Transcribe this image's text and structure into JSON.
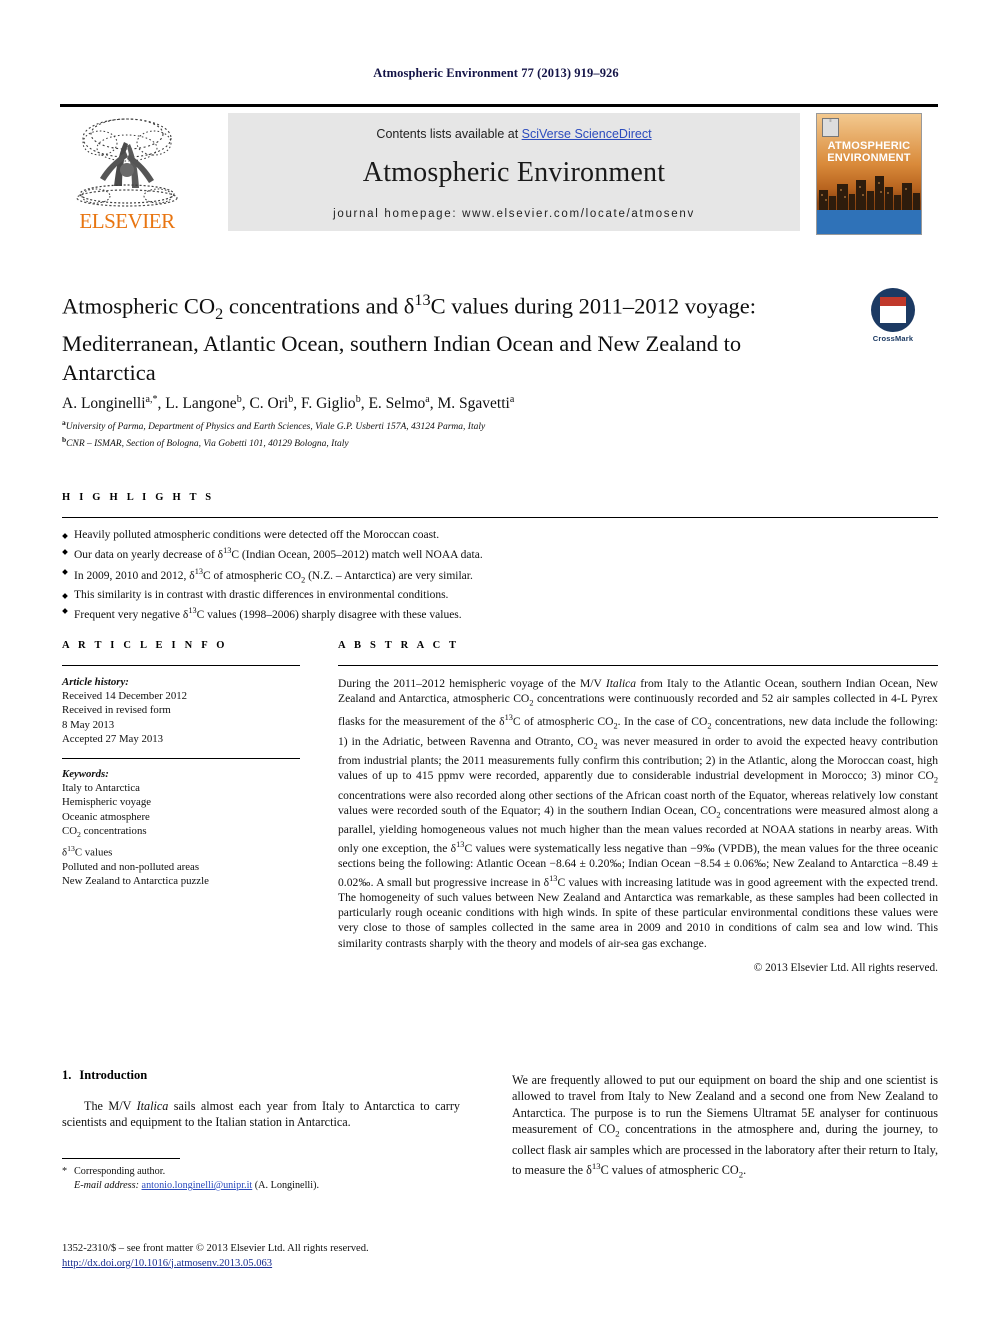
{
  "running_head": "Atmospheric Environment 77 (2013) 919–926",
  "masthead": {
    "publisher_name": "ELSEVIER",
    "contents_prefix": "Contents lists available at ",
    "contents_link": "SciVerse ScienceDirect",
    "journal_name": "Atmospheric Environment",
    "homepage": "journal homepage: www.elsevier.com/locate/atmosenv",
    "cover": {
      "line1": "ATMOSPHERIC",
      "line2": "ENVIRONMENT"
    }
  },
  "article": {
    "title_line1_a": "Atmospheric CO",
    "title_line1_b": " concentrations and δ",
    "title_line1_c": "C values during 2011–2012",
    "title_sub": "2",
    "title_sup": "13",
    "title_line2": "voyage: Mediterranean, Atlantic Ocean, southern Indian Ocean and",
    "title_line3": "New Zealand to Antarctica",
    "crossmark_label": "CrossMark",
    "authors": "A. Longinelli, L. Langone, C. Ori, F. Giglio, E. Selmo, M. Sgavetti",
    "author_list": [
      {
        "name": "A. Longinelli",
        "marks": "a,*"
      },
      {
        "name": "L. Langone",
        "marks": "b"
      },
      {
        "name": "C. Ori",
        "marks": "b"
      },
      {
        "name": "F. Giglio",
        "marks": "b"
      },
      {
        "name": "E. Selmo",
        "marks": "a"
      },
      {
        "name": "M. Sgavetti",
        "marks": "a"
      }
    ],
    "affiliations": [
      {
        "mark": "a",
        "text": "University of Parma, Department of Physics and Earth Sciences, Viale G.P. Usberti 157A, 43124 Parma, Italy"
      },
      {
        "mark": "b",
        "text": "CNR – ISMAR, Section of Bologna, Via Gobetti 101, 40129 Bologna, Italy"
      }
    ]
  },
  "highlights": {
    "heading": "H I G H L I G H T S",
    "items": [
      "Heavily polluted atmospheric conditions were detected off the Moroccan coast.",
      "Our data on yearly decrease of δ13C (Indian Ocean, 2005–2012) match well NOAA data.",
      "In 2009, 2010 and 2012, δ13C of atmospheric CO2 (N.Z. – Antarctica) are very similar.",
      "This similarity is in contrast with drastic differences in environmental conditions.",
      "Frequent very negative δ13C values (1998–2006) sharply disagree with these values."
    ]
  },
  "article_info": {
    "heading": "A R T I C L E  I N F O",
    "history_label": "Article history:",
    "history": [
      "Received 14 December 2012",
      "Received in revised form",
      "8 May 2013",
      "Accepted 27 May 2013"
    ],
    "keywords_label": "Keywords:",
    "keywords": [
      "Italy to Antarctica",
      "Hemispheric voyage",
      "Oceanic atmosphere",
      "CO2 concentrations",
      "δ13C values",
      "Polluted and non-polluted areas",
      "New Zealand to Antarctica puzzle"
    ]
  },
  "abstract": {
    "heading": "A B S T R A C T",
    "text_pre_italic": "During the 2011–2012 hemispheric voyage of the M/V ",
    "italic_ship": "Italica",
    "text_post_italic": " from Italy to the Atlantic Ocean, southern Indian Ocean, New Zealand and Antarctica, atmospheric CO2 concentrations were continuously recorded and 52 air samples collected in 4-L Pyrex flasks for the measurement of the δ13C of atmospheric CO2. In the case of CO2 concentrations, new data include the following: 1) in the Adriatic, between Ravenna and Otranto, CO2 was never measured in order to avoid the expected heavy contribution from industrial plants; the 2011 measurements fully confirm this contribution; 2) in the Atlantic, along the Moroccan coast, high values of up to 415 ppmv were recorded, apparently due to considerable industrial development in Morocco; 3) minor CO2 concentrations were also recorded along other sections of the African coast north of the Equator, whereas relatively low constant values were recorded south of the Equator; 4) in the southern Indian Ocean, CO2 concentrations were measured almost along a parallel, yielding homogeneous values not much higher than the mean values recorded at NOAA stations in nearby areas. With only one exception, the δ13C values were systematically less negative than −9‰ (VPDB), the mean values for the three oceanic sections being the following: Atlantic Ocean −8.64 ± 0.20‰; Indian Ocean −8.54 ± 0.06‰; New Zealand to Antarctica −8.49 ± 0.02‰. A small but progressive increase in δ13C values with increasing latitude was in good agreement with the expected trend. The homogeneity of such values between New Zealand and Antarctica was remarkable, as these samples had been collected in particularly rough oceanic conditions with high winds. In spite of these particular environmental conditions these values were very close to those of samples collected in the same area in 2009 and 2010 in conditions of calm sea and low wind. This similarity contrasts sharply with the theory and models of air-sea gas exchange.",
    "copyright": "© 2013 Elsevier Ltd. All rights reserved."
  },
  "body": {
    "section_number": "1.",
    "section_title": "Introduction",
    "left_paragraph_pre": "The M/V ",
    "left_paragraph_italic": "Italica",
    "left_paragraph_post": " sails almost each year from Italy to Antarctica to carry scientists and equipment to the Italian station in Antarctica.",
    "right_paragraph": "We are frequently allowed to put our equipment on board the ship and one scientist is allowed to travel from Italy to New Zealand and a second one from New Zealand to Antarctica. The purpose is to run the Siemens Ultramat 5E analyser for continuous measurement of CO2 concentrations in the atmosphere and, during the journey, to collect flask air samples which are processed in the laboratory after their return to Italy, to measure the δ13C values of atmospheric CO2."
  },
  "footnote": {
    "star": "*",
    "corresponding": "Corresponding author.",
    "email_label": "E-mail address:",
    "email": "antonio.longinelli@unipr.it",
    "email_attrib": "(A. Longinelli)."
  },
  "footer": {
    "issn_line": "1352-2310/$ – see front matter © 2013 Elsevier Ltd. All rights reserved.",
    "doi": "http://dx.doi.org/10.1016/j.atmosenv.2013.05.063"
  },
  "colors": {
    "running_head": "#141447",
    "elsevier_orange": "#E87511",
    "link_blue": "#2b4bbd",
    "doi_blue": "#1a2f8f",
    "banner_grey": "#e6e6e6",
    "crossmark_navy": "#1c3a63",
    "crossmark_red": "#c0392b"
  }
}
